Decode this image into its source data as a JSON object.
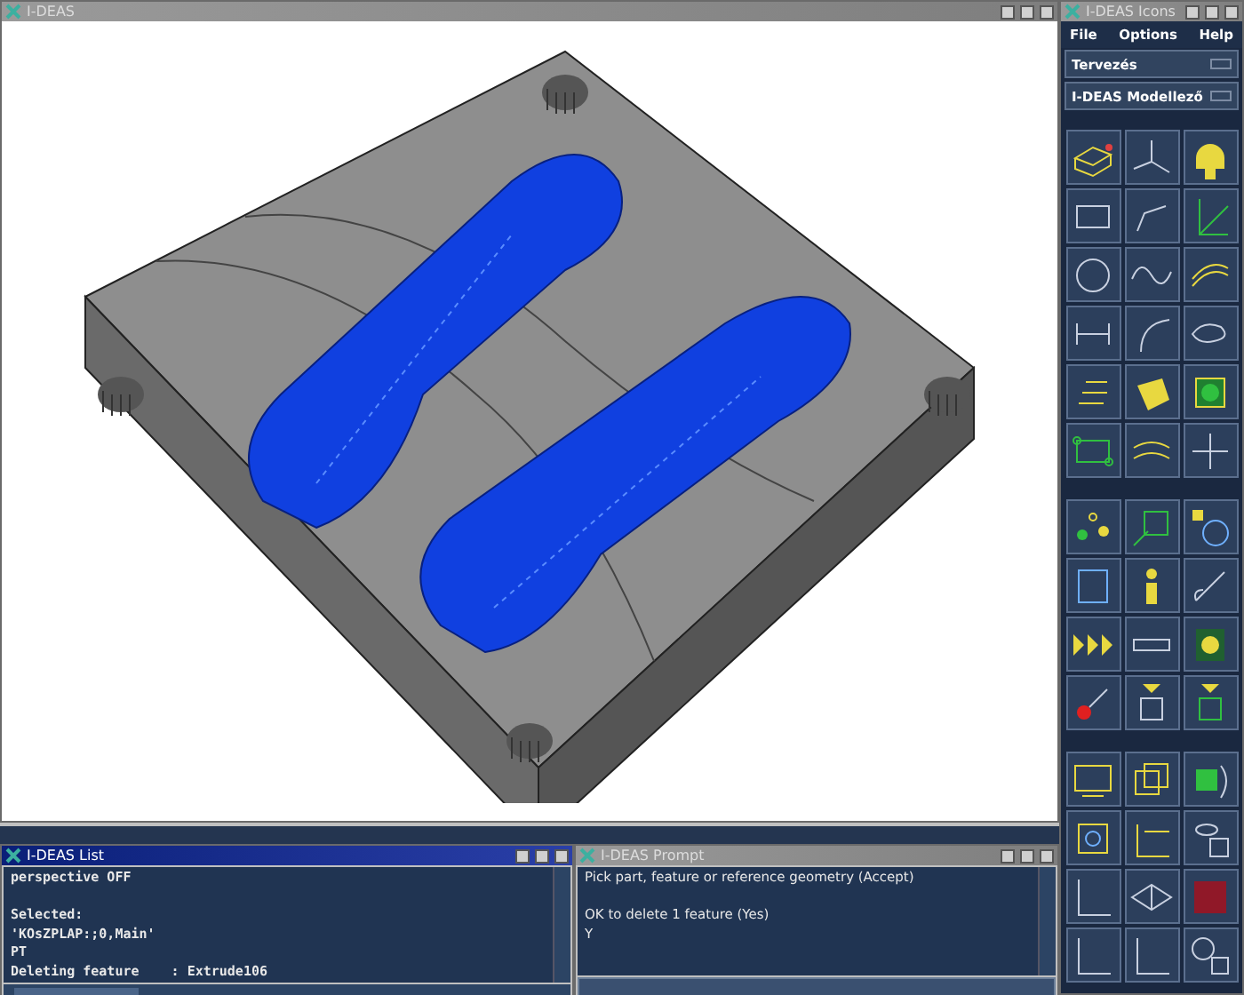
{
  "main_window": {
    "title": "I-DEAS",
    "active": false
  },
  "icons_window": {
    "title": "I-DEAS Icons",
    "active": false,
    "menu": [
      "File",
      "Options",
      "Help"
    ],
    "selectors": [
      "Tervezés",
      "I-DEAS Modellező"
    ]
  },
  "list_window": {
    "title": "I-DEAS List",
    "active": true,
    "blocks": [
      [
        "perspective OFF"
      ],
      [
        "Selected:",
        "'KOsZPLAP:;0,Main'",
        "PT",
        "Deleting feature    : Extrude106"
      ]
    ]
  },
  "prompt_window": {
    "title": "I-DEAS Prompt",
    "active": false,
    "blocks": [
      [
        "Pick part, feature or reference geometry (Accept)"
      ],
      [
        "OK to delete 1 feature (Yes)",
        "Y"
      ]
    ]
  }
}
